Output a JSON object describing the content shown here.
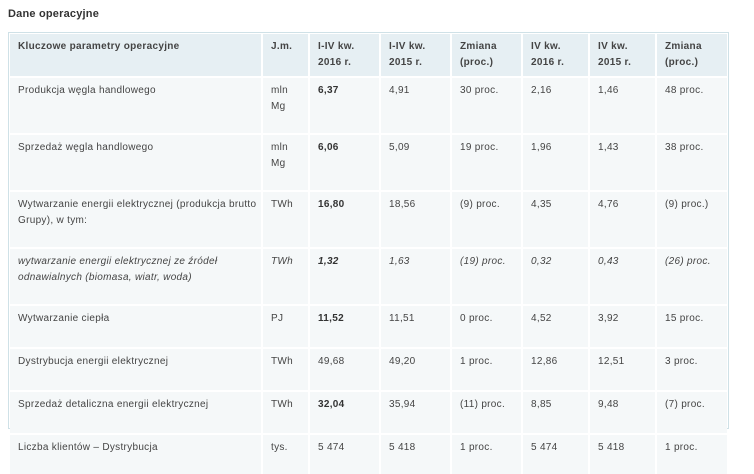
{
  "title": "Dane operacyjne",
  "headers": [
    "Kluczowe parametry operacyjne",
    "J.m.",
    "I-IV kw. 2016 r.",
    "I-IV kw. 2015 r.",
    "Zmiana (proc.)",
    "IV kw. 2016 r.",
    "IV kw. 2015 r.",
    "Zmiana (proc.)"
  ],
  "rows": [
    [
      "Produkcja węgla handlowego",
      "mln Mg",
      "6,37",
      "4,91",
      "30 proc.",
      "2,16",
      "1,46",
      "48 proc."
    ],
    [
      "Sprzedaż węgla handlowego",
      "mln Mg",
      "6,06",
      "5,09",
      "19 proc.",
      "1,96",
      "1,43",
      "38 proc."
    ],
    [
      "Wytwarzanie energii elektrycznej (produkcja brutto Grupy), w tym:",
      "TWh",
      "16,80",
      "18,56",
      "(9) proc.",
      "4,35",
      "4,76",
      "(9) proc.)"
    ],
    [
      "wytwarzanie energii elektrycznej ze źródeł odnawialnych (biomasa, wiatr, woda)",
      "TWh",
      "1,32",
      "1,63",
      "(19) proc.",
      "0,32",
      "0,43",
      "(26) proc."
    ],
    [
      "Wytwarzanie ciepła",
      "PJ",
      "11,52",
      "11,51",
      "0 proc.",
      "4,52",
      "3,92",
      "15 proc."
    ],
    [
      "Dystrybucja energii elektrycznej",
      "TWh",
      "49,68",
      "49,20",
      "1 proc.",
      "12,86",
      "12,51",
      "3 proc."
    ],
    [
      "Sprzedaż detaliczna energii elektrycznej",
      "TWh",
      "32,04",
      "35,94",
      "(11) proc.",
      "8,85",
      "9,48",
      "(7) proc."
    ],
    [
      "Liczba klientów – Dystrybucja",
      "tys.",
      "5 474",
      "5 418",
      "1 proc.",
      "5 474",
      "5 418",
      "1 proc."
    ]
  ]
}
